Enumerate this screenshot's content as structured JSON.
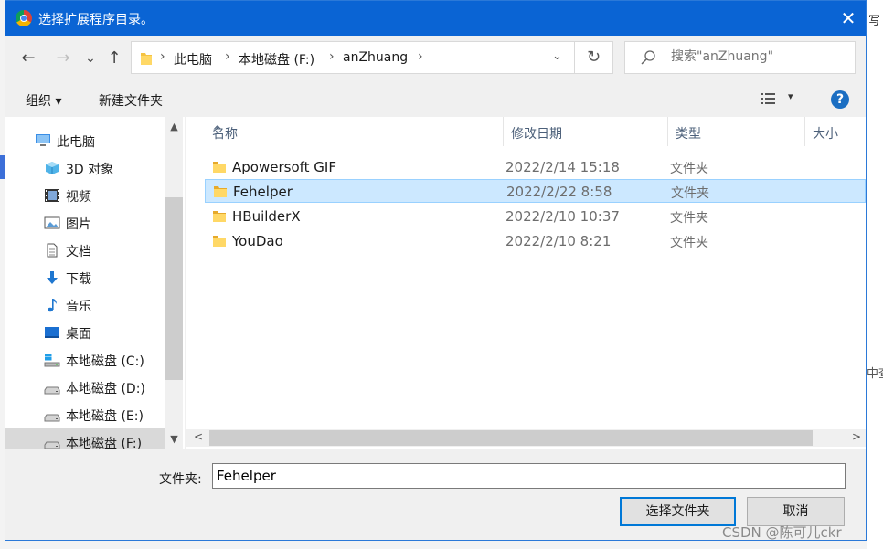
{
  "dialog": {
    "title": "选择扩展程序目录。",
    "close_glyph": "✕"
  },
  "nav": {
    "back": "←",
    "forward": "→",
    "recent": "⌄",
    "up": "↑"
  },
  "address": {
    "breadcrumbs": [
      "此电脑",
      "本地磁盘 (F:)",
      "anZhuang"
    ],
    "separator": "›",
    "dropdown": "⌄",
    "refresh": "↻"
  },
  "search": {
    "placeholder": "搜索\"anZhuang\""
  },
  "toolbar": {
    "organize": "组织 ▾",
    "new_folder": "新建文件夹",
    "view_dropdown": "▾",
    "help": "?"
  },
  "sidebar": {
    "items": [
      {
        "label": "此电脑",
        "icon": "computer-icon"
      },
      {
        "label": "3D 对象",
        "icon": "cube-3d-icon"
      },
      {
        "label": "视频",
        "icon": "video-icon"
      },
      {
        "label": "图片",
        "icon": "picture-icon"
      },
      {
        "label": "文档",
        "icon": "document-icon"
      },
      {
        "label": "下载",
        "icon": "download-icon"
      },
      {
        "label": "音乐",
        "icon": "music-icon"
      },
      {
        "label": "桌面",
        "icon": "desktop-icon"
      },
      {
        "label": "本地磁盘 (C:)",
        "icon": "windows-drive-icon"
      },
      {
        "label": "本地磁盘 (D:)",
        "icon": "drive-icon"
      },
      {
        "label": "本地磁盘 (E:)",
        "icon": "drive-icon"
      },
      {
        "label": "本地磁盘 (F:)",
        "icon": "drive-icon"
      }
    ],
    "selected_index": 11,
    "scroll_up": "▲",
    "scroll_down": "▼"
  },
  "file_list": {
    "columns": [
      "名称",
      "修改日期",
      "类型",
      "大小"
    ],
    "sort_indicator": "^",
    "rows": [
      {
        "name": "Apowersoft GIF",
        "date": "2022/2/14 15:18",
        "type": "文件夹"
      },
      {
        "name": "Fehelper",
        "date": "2022/2/22 8:58",
        "type": "文件夹"
      },
      {
        "name": "HBuilderX",
        "date": "2022/2/10 10:37",
        "type": "文件夹"
      },
      {
        "name": "YouDao",
        "date": "2022/2/10 8:21",
        "type": "文件夹"
      }
    ],
    "selected_index": 1,
    "scroll_left": "<",
    "scroll_right": ">"
  },
  "footer": {
    "folder_label": "文件夹:",
    "folder_value": "Fehelper",
    "select_button": "选择文件夹",
    "cancel_button": "取消"
  },
  "background": {
    "peek_top": "写",
    "peek_mid": "中查"
  },
  "watermark": "CSDN @陈可儿ckr",
  "colors": {
    "titlebar": "#0a64d4",
    "selection": "#cce8ff",
    "selection_border": "#99d1ff",
    "folder": "#f5c342",
    "primary_border": "#0078d7"
  }
}
